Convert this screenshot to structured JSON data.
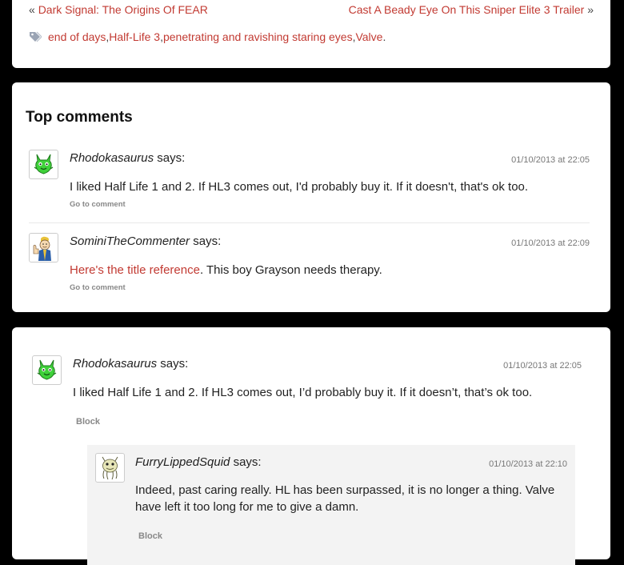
{
  "post_nav": {
    "prev_quote": "«",
    "prev_label": "Dark Signal: The Origins Of FEAR",
    "next_label": "Cast A Beady Eye On This Sniper Elite 3 Trailer",
    "next_quote": "»",
    "tags": [
      "end of days",
      "Half-Life 3",
      "penetrating and ravishing staring eyes",
      "Valve"
    ],
    "tag_sep": ", ",
    "tag_end": "."
  },
  "top_comments": {
    "title": "Top comments",
    "comments": [
      {
        "author": "Rhodokasaurus",
        "says": " says:",
        "date": "01/10/2013 at 22:05",
        "text": "I liked Half Life 1 and 2. If HL3 comes out, I'd probably buy it. If it doesn't, that's ok too.",
        "goto_label": "Go to comment"
      },
      {
        "author": "SominiTheCommenter",
        "says": " says:",
        "date": "01/10/2013 at 22:09",
        "link_text": "Here's the title reference",
        "text_after": ". This boy Grayson needs therapy.",
        "goto_label": "Go to comment"
      }
    ]
  },
  "thread": {
    "comment": {
      "author": "Rhodokasaurus",
      "says": " says:",
      "date": "01/10/2013 at 22:05",
      "text": "I liked Half Life 1 and 2. If HL3 comes out, I’d probably buy it. If it doesn’t, that’s ok too.",
      "block_label": "Block"
    },
    "reply": {
      "author": "FurryLippedSquid",
      "says": " says:",
      "date": "01/10/2013 at 22:10",
      "text_line1": "Indeed, past caring really. HL has been surpassed, it is no longer a thing. Valve",
      "text_line2": "have left it too long for me to give a damn.",
      "block_label": "Block"
    }
  },
  "colors": {
    "link": "#c23a32",
    "background": "#000000",
    "card": "#ffffff",
    "reply_bg": "#f3f3f3"
  },
  "icons": [
    "tag-icon",
    "green-creature-avatar-icon",
    "thumbs-up-vault-boy-avatar-icon",
    "squid-avatar-icon"
  ]
}
